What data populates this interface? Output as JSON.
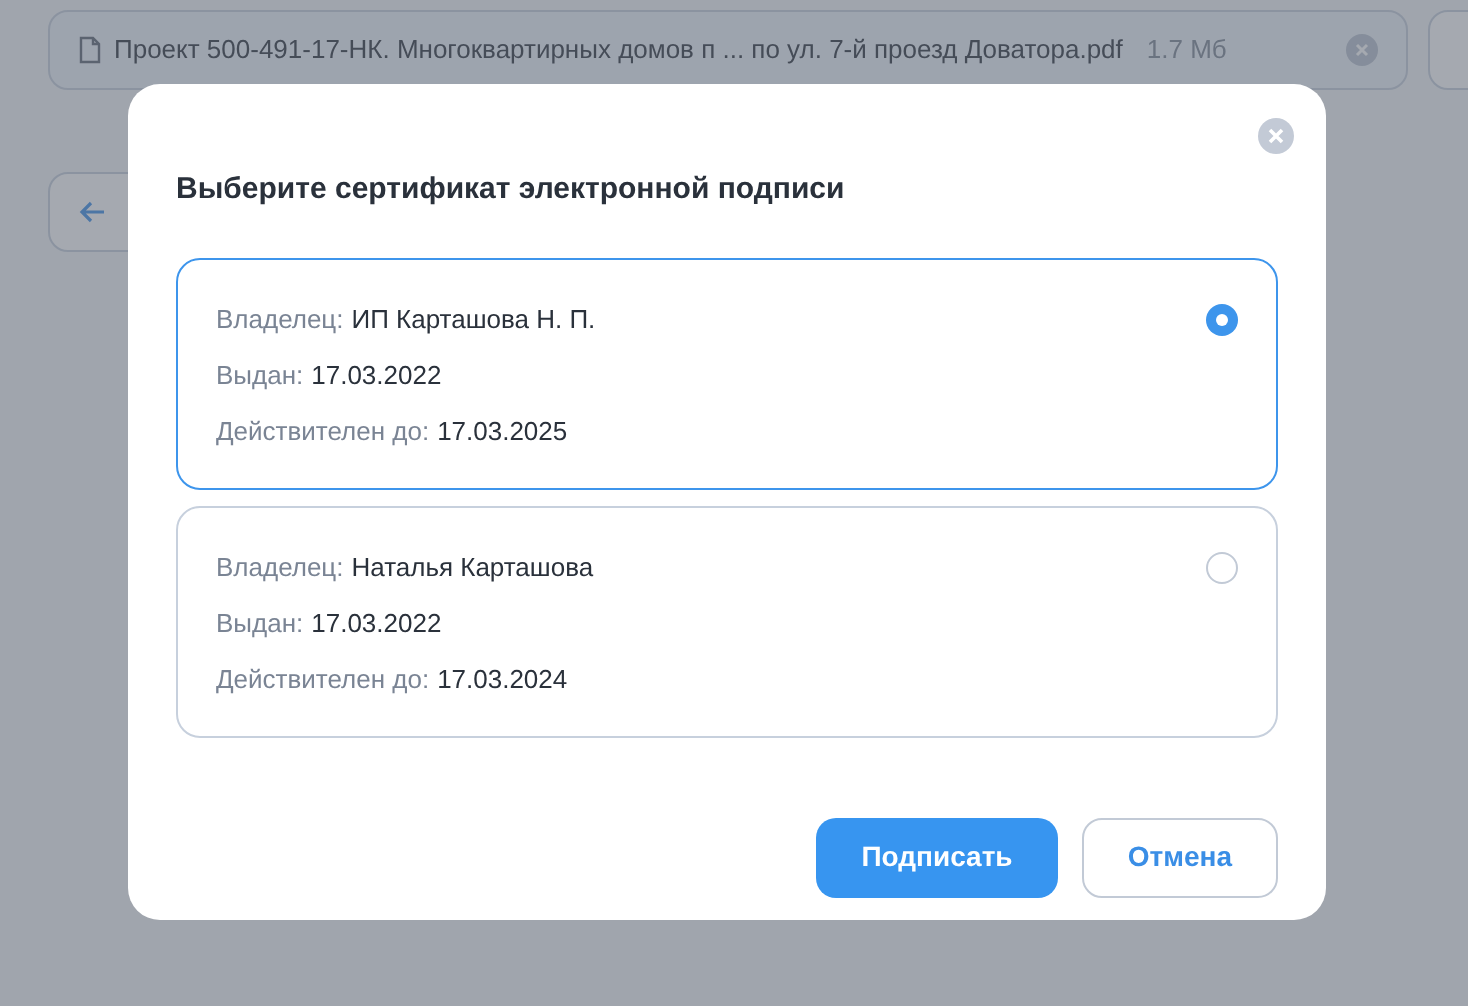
{
  "attachment": {
    "file_name": "Проект 500-491-17-НК. Многоквартирных домов п ... по ул. 7-й проезд Доватора.pdf",
    "size": "1.7 Мб"
  },
  "dialog": {
    "title": "Выберите сертификат электронной подписи",
    "certificates": [
      {
        "owner_label": "Владелец:",
        "owner": "ИП Карташова Н. П.",
        "issued_label": "Выдан:",
        "issued": "17.03.2022",
        "valid_label": "Действителен до:",
        "valid": "17.03.2025",
        "selected": true
      },
      {
        "owner_label": "Владелец:",
        "owner": "Наталья Карташова",
        "issued_label": "Выдан:",
        "issued": "17.03.2022",
        "valid_label": "Действителен до:",
        "valid": "17.03.2024",
        "selected": false
      }
    ],
    "buttons": [
      {
        "label": "Подписать",
        "kind": "primary"
      },
      {
        "label": "Отмена",
        "kind": "secondary"
      }
    ]
  }
}
